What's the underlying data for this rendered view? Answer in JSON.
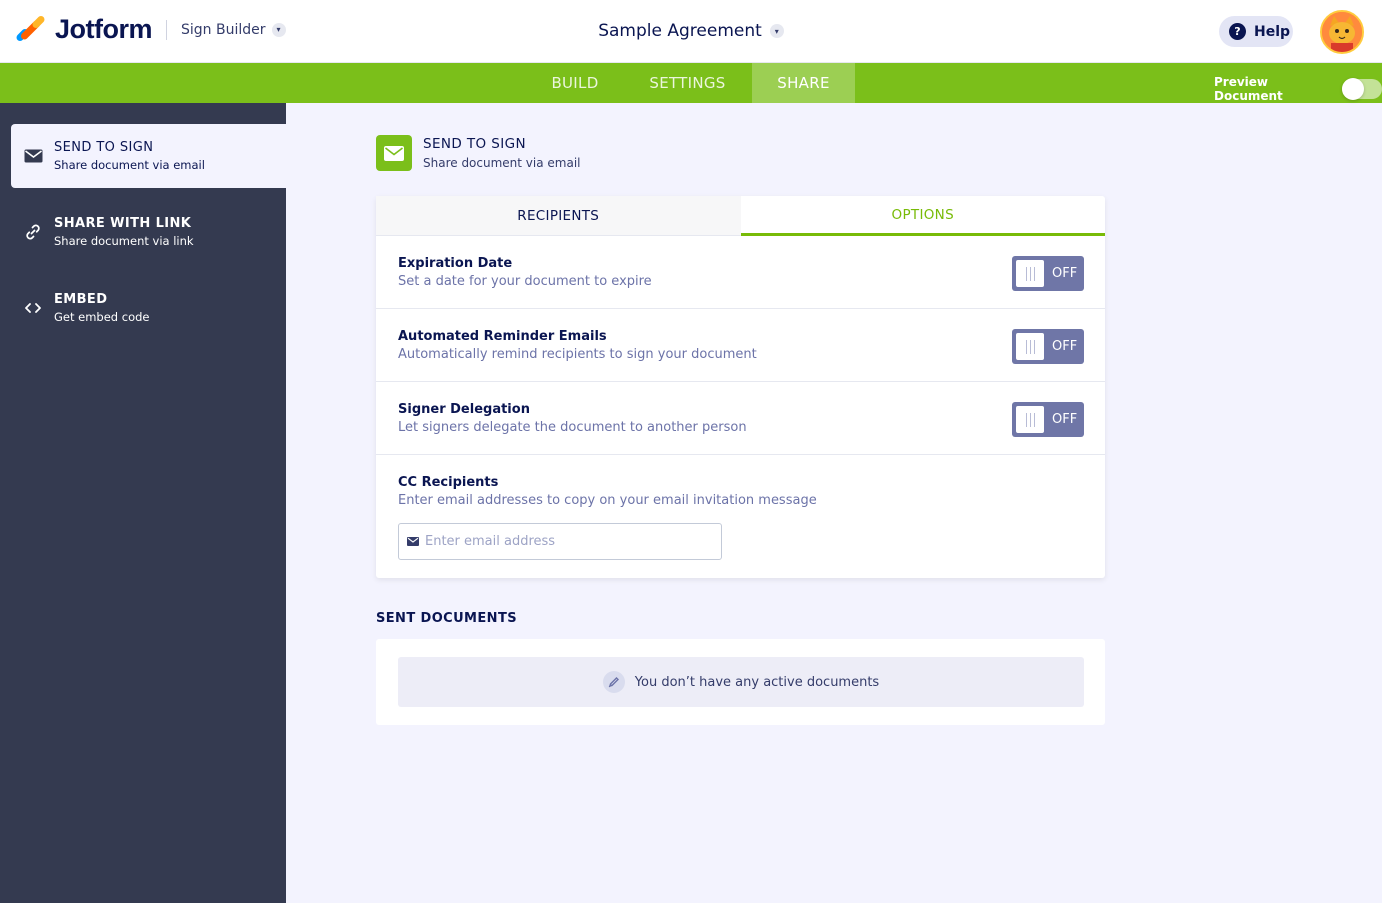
{
  "header": {
    "brand": "Jotform",
    "product": "Sign Builder",
    "document_title": "Sample Agreement",
    "help_label": "Help"
  },
  "nav": {
    "tabs": [
      {
        "label": "BUILD"
      },
      {
        "label": "SETTINGS"
      },
      {
        "label": "SHARE",
        "active": true
      }
    ],
    "preview_label": "Preview Document",
    "preview_on": false
  },
  "sidebar": {
    "items": [
      {
        "title": "SEND TO SIGN",
        "subtitle": "Share document via email",
        "active": true
      },
      {
        "title": "SHARE WITH LINK",
        "subtitle": "Share document via link"
      },
      {
        "title": "EMBED",
        "subtitle": "Get embed code"
      }
    ]
  },
  "main": {
    "section_title": "SEND TO SIGN",
    "section_subtitle": "Share document via email",
    "tabs": {
      "recipients": "RECIPIENTS",
      "options": "OPTIONS"
    },
    "options": [
      {
        "title": "Expiration Date",
        "subtitle": "Set a date for your document to expire",
        "state": "OFF"
      },
      {
        "title": "Automated Reminder Emails",
        "subtitle": "Automatically remind recipients to sign your document",
        "state": "OFF"
      },
      {
        "title": "Signer Delegation",
        "subtitle": "Let signers delegate the document to another person",
        "state": "OFF"
      }
    ],
    "cc": {
      "title": "CC Recipients",
      "subtitle": "Enter email addresses to copy on your email invitation message",
      "placeholder": "Enter email address",
      "value": ""
    },
    "sent": {
      "title": "SENT DOCUMENTS",
      "empty_message": "You don’t have any active documents"
    }
  },
  "colors": {
    "accent_green": "#7bbf1a",
    "sidebar_bg": "#343a50",
    "toggle_off": "#6f76a7",
    "text_dark": "#0a1551"
  }
}
